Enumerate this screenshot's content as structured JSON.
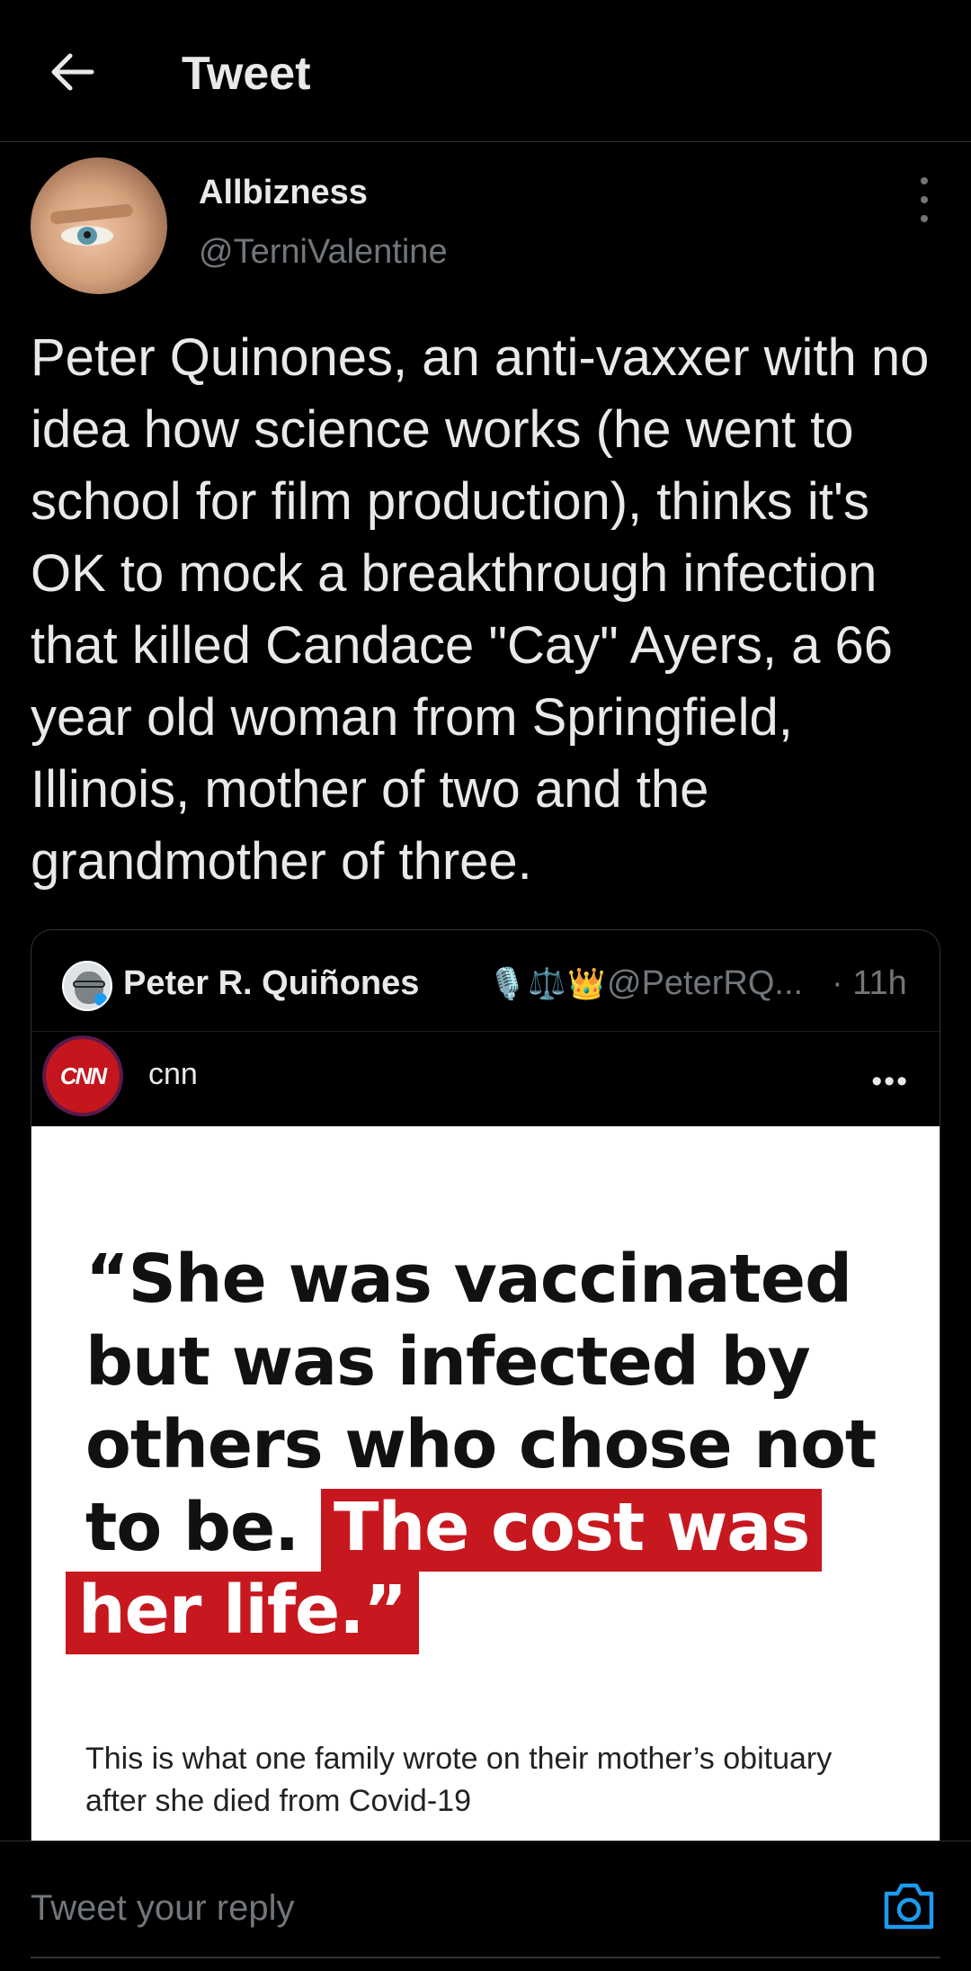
{
  "header": {
    "title": "Tweet",
    "back_icon": "arrow-left-icon"
  },
  "tweet": {
    "author": {
      "display_name": "Allbizness",
      "handle": "@TerniValentine"
    },
    "text": "Peter Quinones, an anti-vaxxer with no idea how science works (he went to school for film production), thinks it's OK to mock a breakthrough infection that killed Candace \"Cay\" Ayers, a 66 year old woman from Springfield, Illinois, mother of two and the grandmother of three.",
    "more_icon": "more-vertical-icon"
  },
  "quote": {
    "author_name": "Peter R. Quiñones",
    "emojis": [
      "🎙️",
      "⚖️",
      "👑"
    ],
    "handle": "@PeterRQ...",
    "time": "· 11h",
    "embed": {
      "account_logo": "CNN",
      "account_name": "cnn",
      "more": "•••",
      "quote_lines": [
        "“She was vaccinated",
        "but was infected by",
        "others who chose not",
        "to be."
      ],
      "highlight_1": "The cost was",
      "highlight_2": "her life.”",
      "caption": "This is what one family wrote on their mother’s obituary after she died from Covid-19"
    }
  },
  "reply": {
    "placeholder": "Tweet your reply",
    "camera_icon": "camera-icon"
  },
  "colors": {
    "background": "#000000",
    "text": "#e7e9ea",
    "muted": "#71767b",
    "accent": "#1d9bf0",
    "highlight_red": "#c7181f"
  }
}
